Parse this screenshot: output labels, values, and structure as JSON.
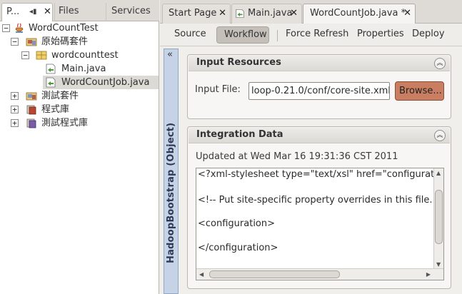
{
  "left_panel": {
    "tabs": [
      {
        "label": "P..."
      },
      {
        "label": "Files"
      },
      {
        "label": "Services"
      }
    ],
    "tree": [
      {
        "label": "WordCountTest",
        "icon": "project-icon",
        "expander": "−"
      },
      {
        "label": "原始碼套件",
        "icon": "source-packages-icon",
        "expander": "−"
      },
      {
        "label": "wordcounttest",
        "icon": "package-icon",
        "expander": "−"
      },
      {
        "label": "Main.java",
        "icon": "java-file-icon"
      },
      {
        "label": "WordCountJob.java",
        "icon": "java-file-icon",
        "selected": true
      },
      {
        "label": "測試套件",
        "icon": "test-packages-icon",
        "expander": "+"
      },
      {
        "label": "程式庫",
        "icon": "libraries-icon",
        "expander": "+"
      },
      {
        "label": "測試程式庫",
        "icon": "test-libraries-icon",
        "expander": "+"
      }
    ]
  },
  "editor": {
    "tabs": [
      {
        "label": "Start Page"
      },
      {
        "label": "Main.java"
      },
      {
        "label": "WordCountJob.java *",
        "active": true
      }
    ],
    "toolbar": {
      "source": "Source",
      "workflow": "Workflow",
      "force_refresh": "Force Refresh",
      "properties": "Properties",
      "deploy": "Deploy"
    },
    "side_strip_title": "HadoopBootstrap (Object)",
    "input_resources": {
      "title": "Input Resources",
      "field_label": "Input File:",
      "field_value": "loop-0.21.0/conf/core-site.xml",
      "browse": "Browse..."
    },
    "integration_data": {
      "title": "Integration Data",
      "updated": "Updated at Wed Mar 16 19:31:36 CST 2011",
      "xml_lines": [
        "<?xml-stylesheet type=\"text/xsl\" href=\"configuratio",
        "<!-- Put site-specific property overrides in this file. --",
        "<configuration>",
        "</configuration>"
      ]
    }
  },
  "colors": {
    "browse_button": "#c97e62",
    "side_strip": "#c6d3e6",
    "workflow_active": "#c4c0b9"
  }
}
